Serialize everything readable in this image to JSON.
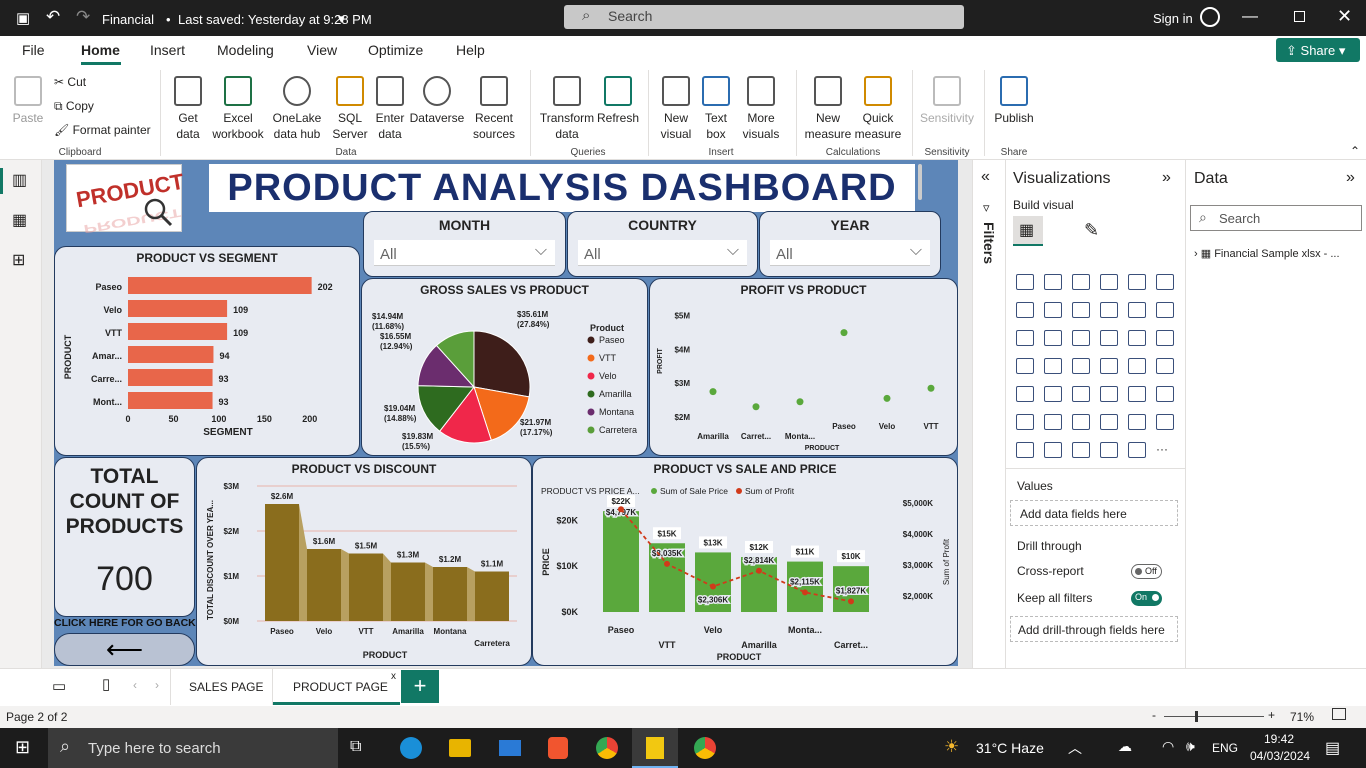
{
  "titlebar": {
    "doc": "Financial",
    "saved": "Last saved: Yesterday at 9:28 PM",
    "search": "Search",
    "signin": "Sign in"
  },
  "menu": [
    "File",
    "Home",
    "Insert",
    "Modeling",
    "View",
    "Optimize",
    "Help"
  ],
  "share": "Share",
  "ribbon": {
    "paste": "Paste",
    "cut": "Cut",
    "copy": "Copy",
    "format_painter": "Format painter",
    "clipboard": "Clipboard",
    "get_data": "Get data",
    "excel": "Excel workbook",
    "onelake": "OneLake data hub",
    "sql": "SQL Server",
    "enter": "Enter data",
    "dataverse": "Dataverse",
    "recent": "Recent sources",
    "data_group": "Data",
    "transform": "Transform data",
    "refresh": "Refresh",
    "queries": "Queries",
    "new_visual": "New visual",
    "text_box": "Text box",
    "more_visuals": "More visuals",
    "insert": "Insert",
    "new_measure": "New measure",
    "quick_measure": "Quick measure",
    "calculations": "Calculations",
    "sensitivity": "Sensitivity",
    "sensitivity_group": "Sensitivity",
    "publish": "Publish",
    "share_group": "Share"
  },
  "dashboard": {
    "title": "PRODUCT ANALYSIS DASHBOARD",
    "logo": "PRODUCT",
    "slicers": [
      {
        "label": "MONTH",
        "value": "All"
      },
      {
        "label": "COUNTRY",
        "value": "All"
      },
      {
        "label": "YEAR",
        "value": "All"
      }
    ],
    "kpi": {
      "label": "TOTAL COUNT OF PRODUCTS",
      "value": "700"
    },
    "back_label": "CLICK HERE FOR GO BACK"
  },
  "chart_data": [
    {
      "type": "bar",
      "title": "PRODUCT VS SEGMENT",
      "xlabel": "SEGMENT",
      "ylabel": "PRODUCT",
      "categories": [
        "Paseo",
        "Velo",
        "VTT",
        "Amar...",
        "Carre...",
        "Mont..."
      ],
      "values": [
        202,
        109,
        109,
        94,
        93,
        93
      ],
      "xticks": [
        "0",
        "50",
        "100",
        "150",
        "200"
      ],
      "xlim": [
        0,
        220
      ],
      "color": "#e8664a"
    },
    {
      "type": "pie",
      "title": "GROSS SALES VS PRODUCT",
      "legend_title": "Product",
      "categories": [
        "Paseo",
        "VTT",
        "Velo",
        "Amarilla",
        "Montana",
        "Carretera"
      ],
      "colors": [
        "#3e1e1a",
        "#f36a1a",
        "#f0274a",
        "#2e6b1f",
        "#6b2d6e",
        "#5a9e3a"
      ],
      "values": [
        35.61,
        21.97,
        19.83,
        19.04,
        16.55,
        14.94
      ],
      "labels": [
        "$35.61M (27.84%)",
        "$21.97M (17.17%)",
        "$19.83M (15.5%)",
        "$19.04M (14.88%)",
        "$16.55M (12.94%)",
        "$14.94M (11.68%)"
      ]
    },
    {
      "type": "scatter",
      "title": "PROFIT VS PRODUCT",
      "xlabel": "PRODUCT",
      "ylabel": "PROFIT",
      "categories": [
        "Amarilla",
        "Carret...",
        "Monta...",
        "Paseo",
        "Velo",
        "VTT"
      ],
      "values": [
        2.75,
        2.3,
        2.45,
        4.5,
        2.55,
        2.85
      ],
      "yticks": [
        "$2M",
        "$3M",
        "$4M",
        "$5M"
      ],
      "ylim": [
        1.7,
        5.2
      ],
      "color": "#5aa83c"
    },
    {
      "type": "bar",
      "title": "PRODUCT VS DISCOUNT",
      "xlabel": "PRODUCT",
      "ylabel": "TOTAL DISCOUNT OVER YEA...",
      "categories": [
        "Paseo",
        "Velo",
        "VTT",
        "Amarilla",
        "Montana",
        "Carretera"
      ],
      "values": [
        2.6,
        1.6,
        1.5,
        1.3,
        1.2,
        1.1
      ],
      "labels": [
        "$2.6M",
        "$1.6M",
        "$1.5M",
        "$1.3M",
        "$1.2M",
        "$1.1M"
      ],
      "yticks": [
        "$0M",
        "$1M",
        "$2M",
        "$3M"
      ],
      "ylim": [
        0,
        3
      ],
      "color": "#8a6d1d"
    },
    {
      "type": "bar",
      "title": "PRODUCT VS SALE AND PRICE",
      "subtitle": "PRODUCT VS PRICE A...",
      "legend": [
        "Sum of Sale Price",
        "Sum of Profit"
      ],
      "xlabel": "PRODUCT",
      "ylabel": "PRICE",
      "y2label": "Sum of Profit",
      "categories": [
        "Paseo",
        "VTT",
        "Velo",
        "Amarilla",
        "Monta...",
        "Carret..."
      ],
      "bar_values": [
        22,
        15,
        13,
        12,
        11,
        10
      ],
      "bar_labels": [
        "$22K",
        "$15K",
        "$13K",
        "$12K",
        "$11K",
        "$10K"
      ],
      "line_values": [
        4797,
        3035,
        2306,
        2814,
        2115,
        1827
      ],
      "line_labels": [
        "$4,797K",
        "$3,035K",
        "$2,306K",
        "$2,814K",
        "$2,115K",
        "$1,827K"
      ],
      "yticks": [
        "$0K",
        "$10K",
        "$20K"
      ],
      "y2ticks": [
        "$2,000K",
        "$3,000K",
        "$4,000K",
        "$5,000K"
      ],
      "colors": {
        "bar": "#5aa83c",
        "line": "#d13a1a"
      }
    }
  ],
  "panes": {
    "filters": "Filters",
    "viz_title": "Visualizations",
    "build_visual": "Build visual",
    "values": "Values",
    "add_data_fields": "Add data fields here",
    "drill_through": "Drill through",
    "cross_report": "Cross-report",
    "cross_state": "Off",
    "keep_filters": "Keep all filters",
    "keep_state": "On",
    "add_drill": "Add drill-through fields here",
    "data_title": "Data",
    "data_search": "Search",
    "table": "Financial Sample xlsx - ..."
  },
  "tabs": [
    "SALES PAGE",
    "PRODUCT PAGE"
  ],
  "status": {
    "page": "Page 2 of 2",
    "zoom": "71%"
  },
  "taskbar": {
    "search": "Type here to search",
    "weather": "31°C  Haze",
    "lang": "ENG",
    "time": "19:42",
    "date": "04/03/2024"
  }
}
